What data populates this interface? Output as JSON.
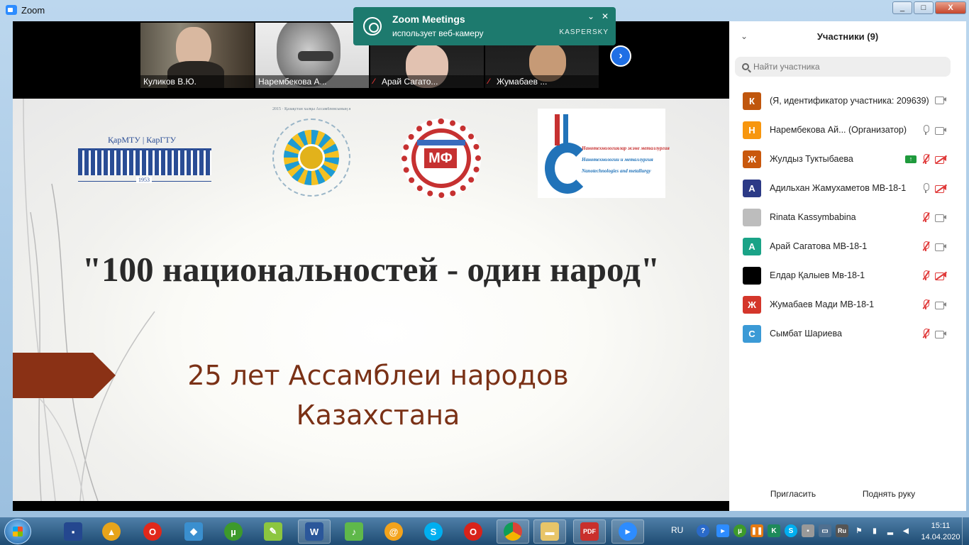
{
  "window": {
    "title": "Zoom",
    "controls": [
      "_",
      "□",
      "X"
    ]
  },
  "notification": {
    "title": "Zoom Meetings",
    "text": "использует веб-камеру",
    "brand": "KASPERSKY",
    "collapse": "⌄",
    "close": "✕"
  },
  "video_strip": [
    {
      "name": "Куликов В.Ю.",
      "muted": false
    },
    {
      "name": "Нарембекова А...",
      "muted": false
    },
    {
      "name": "Арай Сагато...",
      "muted": true
    },
    {
      "name": "Жумабаев ...",
      "muted": true
    }
  ],
  "slide": {
    "headline": "\"100 национальностей - один народ\"",
    "subtitle_line1": "25 лет Ассамблеи народов",
    "subtitle_line2": "Казахстана",
    "logo1_name": "ҚарМТУ | КарГТУ",
    "logo1_year": "1953",
    "logo3_text": "МФ",
    "logo4_line1": "Нанотехнологиялар және металлургия",
    "logo4_line2": "Нанотехнологии и металлургия",
    "logo4_line3": "Nanotechnologies and metallurgy",
    "logo2_ring": "2015 · Қазақстан халқы Ассамблеясының жылы"
  },
  "panel": {
    "title": "Участники (9)",
    "search_placeholder": "Найти участника",
    "participants": [
      {
        "initial": "К",
        "color": "#c0560d",
        "name": "(Я, идентификатор участника: 209639)",
        "mic": "none",
        "cam": "on",
        "share": false
      },
      {
        "initial": "Н",
        "color": "#f7960e",
        "name": "Нарембекова Ай...  (Организатор)",
        "mic": "on",
        "cam": "on",
        "share": false
      },
      {
        "initial": "Ж",
        "color": "#c9580d",
        "name": "Жулдыз Туктыбаева",
        "mic": "muted",
        "cam": "muted",
        "share": true
      },
      {
        "initial": "А",
        "color": "#2c3a86",
        "name": "Адильхан Жамухаметов МВ-18-1",
        "mic": "on",
        "cam": "muted",
        "share": false
      },
      {
        "initial": "",
        "color": "#bdbdbd",
        "name": "Rinata Kassymbabina",
        "mic": "muted",
        "cam": "on",
        "share": false
      },
      {
        "initial": "А",
        "color": "#1aa387",
        "name": "Арай Сагатова МВ-18-1",
        "mic": "muted",
        "cam": "on",
        "share": false
      },
      {
        "initial": "",
        "color": "#000000",
        "name": "Елдар Қалыев Мв-18-1",
        "mic": "muted",
        "cam": "muted",
        "share": false
      },
      {
        "initial": "Ж",
        "color": "#d4362b",
        "name": "Жумабаев Мади МВ-18-1",
        "mic": "muted",
        "cam": "on",
        "share": false
      },
      {
        "initial": "С",
        "color": "#3b9ad6",
        "name": "Сымбат Шариева",
        "mic": "muted",
        "cam": "on",
        "share": false
      }
    ],
    "invite_label": "Пригласить",
    "raise_hand_label": "Поднять руку"
  },
  "taskbar": {
    "language": "RU",
    "tray_lang_badge": "Ru",
    "time": "15:11",
    "date": "14.04.2020"
  }
}
